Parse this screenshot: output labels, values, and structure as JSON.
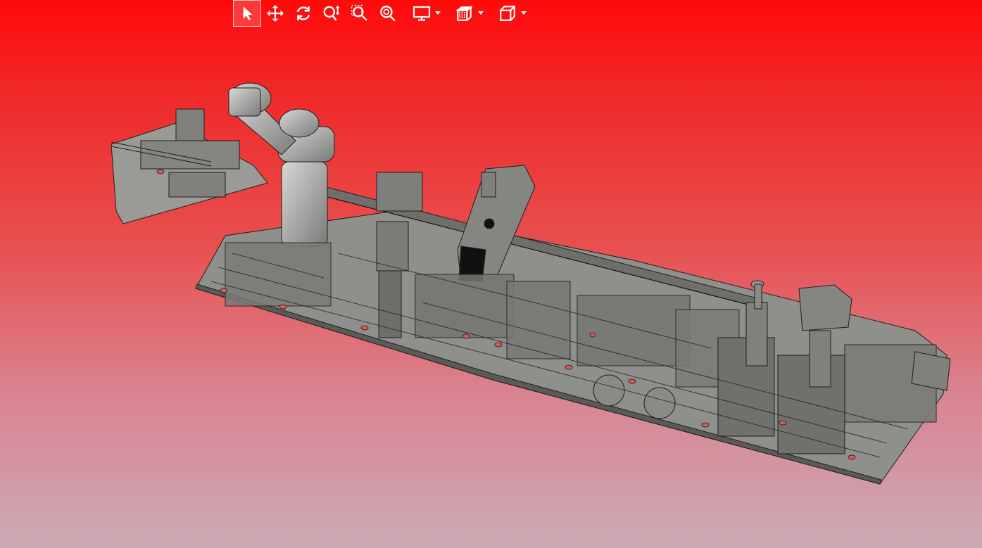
{
  "viewer": {
    "background_top": "#ff0a0a",
    "background_bottom": "#ccaab4",
    "model_color": "#8c8c88",
    "model_edge_color": "#1e1e1e"
  },
  "toolbar": {
    "tools": [
      {
        "id": "select",
        "icon": "cursor-arrow-icon",
        "active": true
      },
      {
        "id": "pan",
        "icon": "move-arrows-icon",
        "active": false
      },
      {
        "id": "rotate",
        "icon": "rotate-icon",
        "active": false
      },
      {
        "id": "zoom",
        "icon": "zoom-updown-icon",
        "active": false
      },
      {
        "id": "zoom-window",
        "icon": "zoom-window-icon",
        "active": false
      },
      {
        "id": "zoom-fit",
        "icon": "zoom-fit-icon",
        "active": false
      }
    ],
    "dropdowns": [
      {
        "id": "display",
        "icon": "monitor-icon"
      },
      {
        "id": "section",
        "icon": "section-box-icon"
      },
      {
        "id": "view",
        "icon": "cube-view-icon"
      }
    ]
  }
}
